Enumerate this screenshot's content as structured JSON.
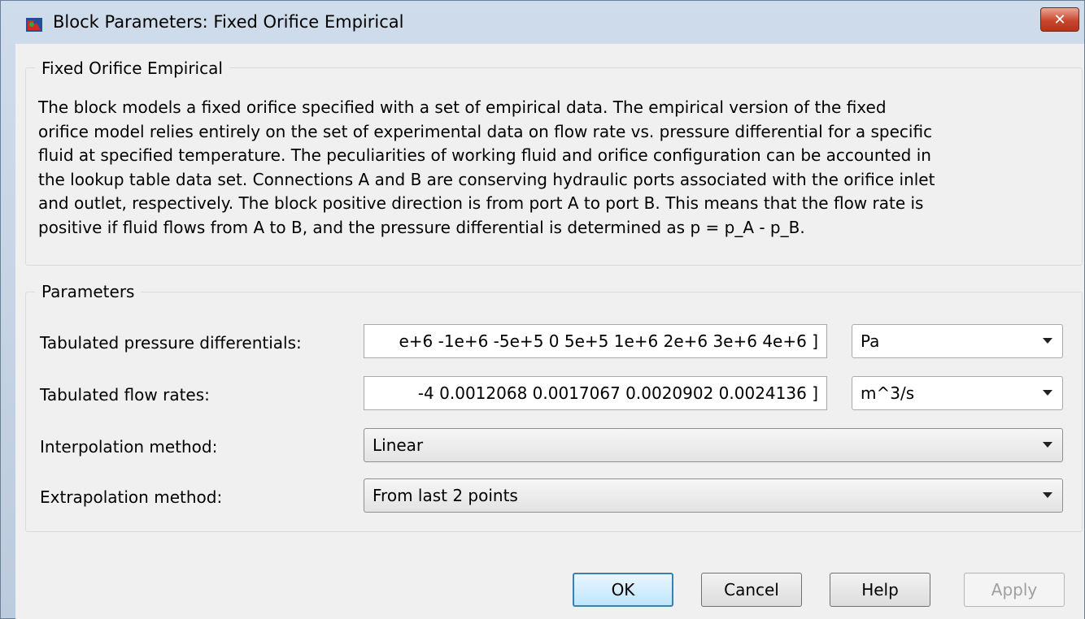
{
  "window": {
    "title": "Block Parameters: Fixed Orifice Empirical",
    "close_label": "✕"
  },
  "description_group": {
    "title": "Fixed Orifice Empirical",
    "lines": [
      "The block models a fixed orifice specified with a set of empirical data. The empirical version of the fixed",
      "orifice model relies entirely on the set of experimental data on flow rate vs. pressure differential for a specific",
      "fluid at specified temperature. The peculiarities of working fluid and orifice configuration can be accounted in",
      "the lookup table data set. Connections A and B are conserving hydraulic ports associated with the orifice inlet",
      "and outlet, respectively. The block positive direction is from port A to port B. This means that the flow rate is",
      "positive if fluid flows from A to B, and the pressure differential is determined as p = p_A - p_B."
    ]
  },
  "parameters_group": {
    "title": "Parameters",
    "pressure": {
      "label": "Tabulated pressure differentials:",
      "value": "e+6 -1e+6 -5e+5 0 5e+5 1e+6 2e+6 3e+6 4e+6 ]",
      "unit": "Pa"
    },
    "flow": {
      "label": "Tabulated flow rates:",
      "value": "-4 0.0012068 0.0017067 0.0020902 0.0024136 ]",
      "unit": "m^3/s"
    },
    "interpolation": {
      "label": "Interpolation method:",
      "value": "Linear"
    },
    "extrapolation": {
      "label": "Extrapolation method:",
      "value": "From last 2 points"
    }
  },
  "buttons": {
    "ok": "OK",
    "cancel": "Cancel",
    "help": "Help",
    "apply": "Apply"
  },
  "icons": {
    "app": "simulink-block-icon",
    "close": "close-icon",
    "dropdown": "chevron-down-icon"
  }
}
